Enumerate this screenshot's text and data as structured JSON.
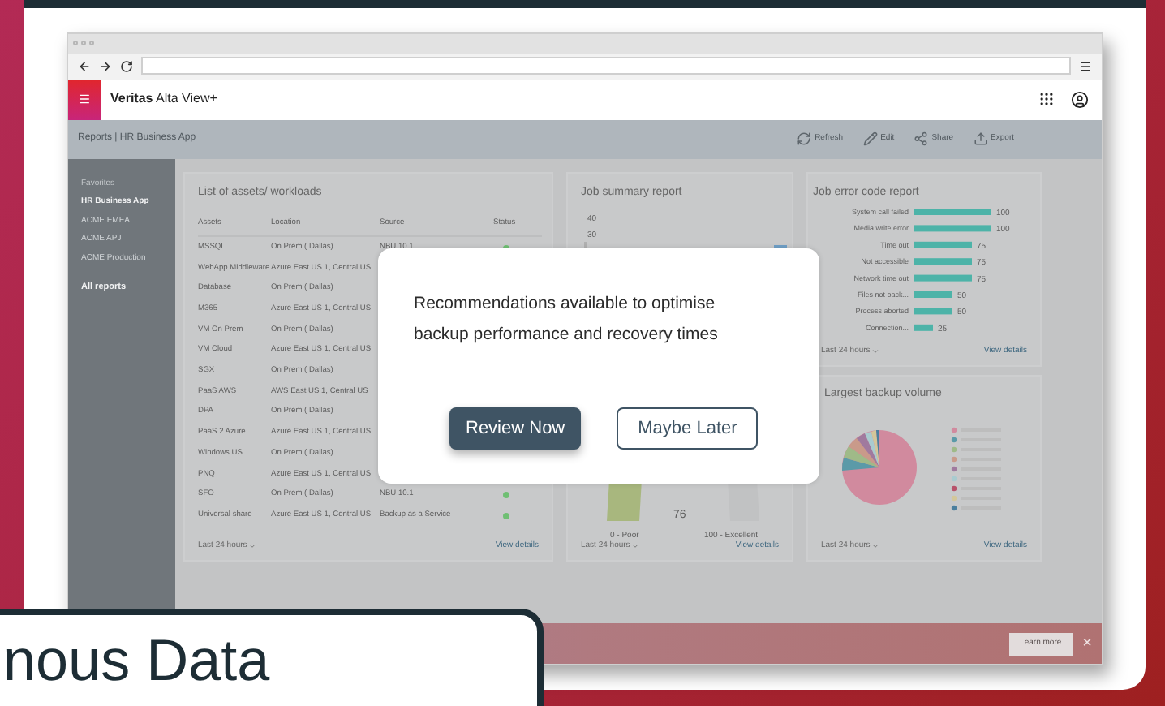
{
  "browser": {
    "nav": [
      {
        "kind": "back"
      },
      {
        "kind": "forward"
      },
      {
        "kind": "reload"
      }
    ]
  },
  "app": {
    "title": "**Veritas** Alta View+"
  },
  "breadcrumb": "Reports | HR Business App",
  "toolbar": [
    {
      "label": "Refresh",
      "kind": "refresh"
    },
    {
      "label": "Edit",
      "kind": "edit"
    },
    {
      "label": "Share",
      "kind": "share"
    },
    {
      "label": "Export",
      "kind": "export"
    }
  ],
  "sidebar": {
    "heading": "Favorites",
    "items": [
      {
        "label": "HR Business App",
        "selected": true
      },
      {
        "label": "ACME EMEA",
        "selected": false
      },
      {
        "label": "ACME APJ",
        "selected": false
      },
      {
        "label": "ACME Production",
        "selected": false
      }
    ],
    "all_reports": "All reports"
  },
  "assets_card": {
    "title": "List of assets/ workloads",
    "columns": [
      "Assets",
      "Location",
      "Source",
      "Status"
    ],
    "rows": [
      {
        "asset": "MSSQL",
        "location": "On Prem ( Dallas)",
        "source": "NBU 10.1",
        "color": "#6fbf73"
      },
      {
        "asset": "WebApp Middleware",
        "location": "Azure East US 1, Central US"
      },
      {
        "asset": "Database",
        "location": "On Prem ( Dallas)"
      },
      {
        "asset": "M365",
        "location": "Azure East US 1, Central US"
      },
      {
        "asset": "VM On Prem",
        "location": "On Prem ( Dallas)"
      },
      {
        "asset": "VM Cloud",
        "location": "Azure East US 1, Central US"
      },
      {
        "asset": "SGX",
        "location": "On Prem ( Dallas)"
      },
      {
        "asset": "PaaS AWS",
        "location": "AWS East US 1, Central US"
      },
      {
        "asset": "DPA",
        "location": "On Prem ( Dallas)"
      },
      {
        "asset": "PaaS 2 Azure",
        "location": "Azure East US 1, Central US"
      },
      {
        "asset": "Windows US",
        "location": "On Prem ( Dallas)"
      },
      {
        "asset": "PNQ",
        "location": "Azure East US 1, Central US"
      },
      {
        "asset": "SFO",
        "location": "On Prem ( Dallas)",
        "source": "NBU 10.1",
        "color": "#6fbf73"
      },
      {
        "asset": "Universal share",
        "location": "Azure East US 1, Central US",
        "source": "Backup as a Service",
        "color": "#6fbf73"
      }
    ],
    "footer": {
      "range": "Last 24 hours",
      "link": "View details"
    }
  },
  "summary_card": {
    "title": "Job summary report",
    "y_ticks": [
      "40",
      "30"
    ],
    "gauge_value": "76",
    "gauge_min": "0 - Poor",
    "gauge_max": "100 - Excellent",
    "footer": {
      "range": "Last 24 hours",
      "link": "View details"
    }
  },
  "error_card": {
    "title": "Job error code report",
    "chart_data": {
      "type": "bar",
      "orientation": "horizontal",
      "categories": [
        "System call failed",
        "Media write error",
        "Time out",
        "Not accessible",
        "Network time out",
        "Files not back...",
        "Process aborted",
        "Connection..."
      ],
      "values": [
        100,
        100,
        75,
        75,
        75,
        50,
        50,
        25
      ],
      "data_labels": true
    },
    "footer": {
      "range": "Last 24 hours",
      "link": "View details"
    }
  },
  "volume_card": {
    "title": "Largest backup volume",
    "footer": {
      "range": "Last 24 hours",
      "link": "View details"
    }
  },
  "modal": {
    "message": "Recommendations available to optimise backup performance and recovery times",
    "buttons": [
      {
        "label": "Review Now",
        "kind": "primary"
      },
      {
        "label": "Maybe Later",
        "kind": "secondary"
      }
    ]
  },
  "banner": {
    "button": "Learn more",
    "close": "×"
  },
  "callout": {
    "text": "nous Data"
  }
}
